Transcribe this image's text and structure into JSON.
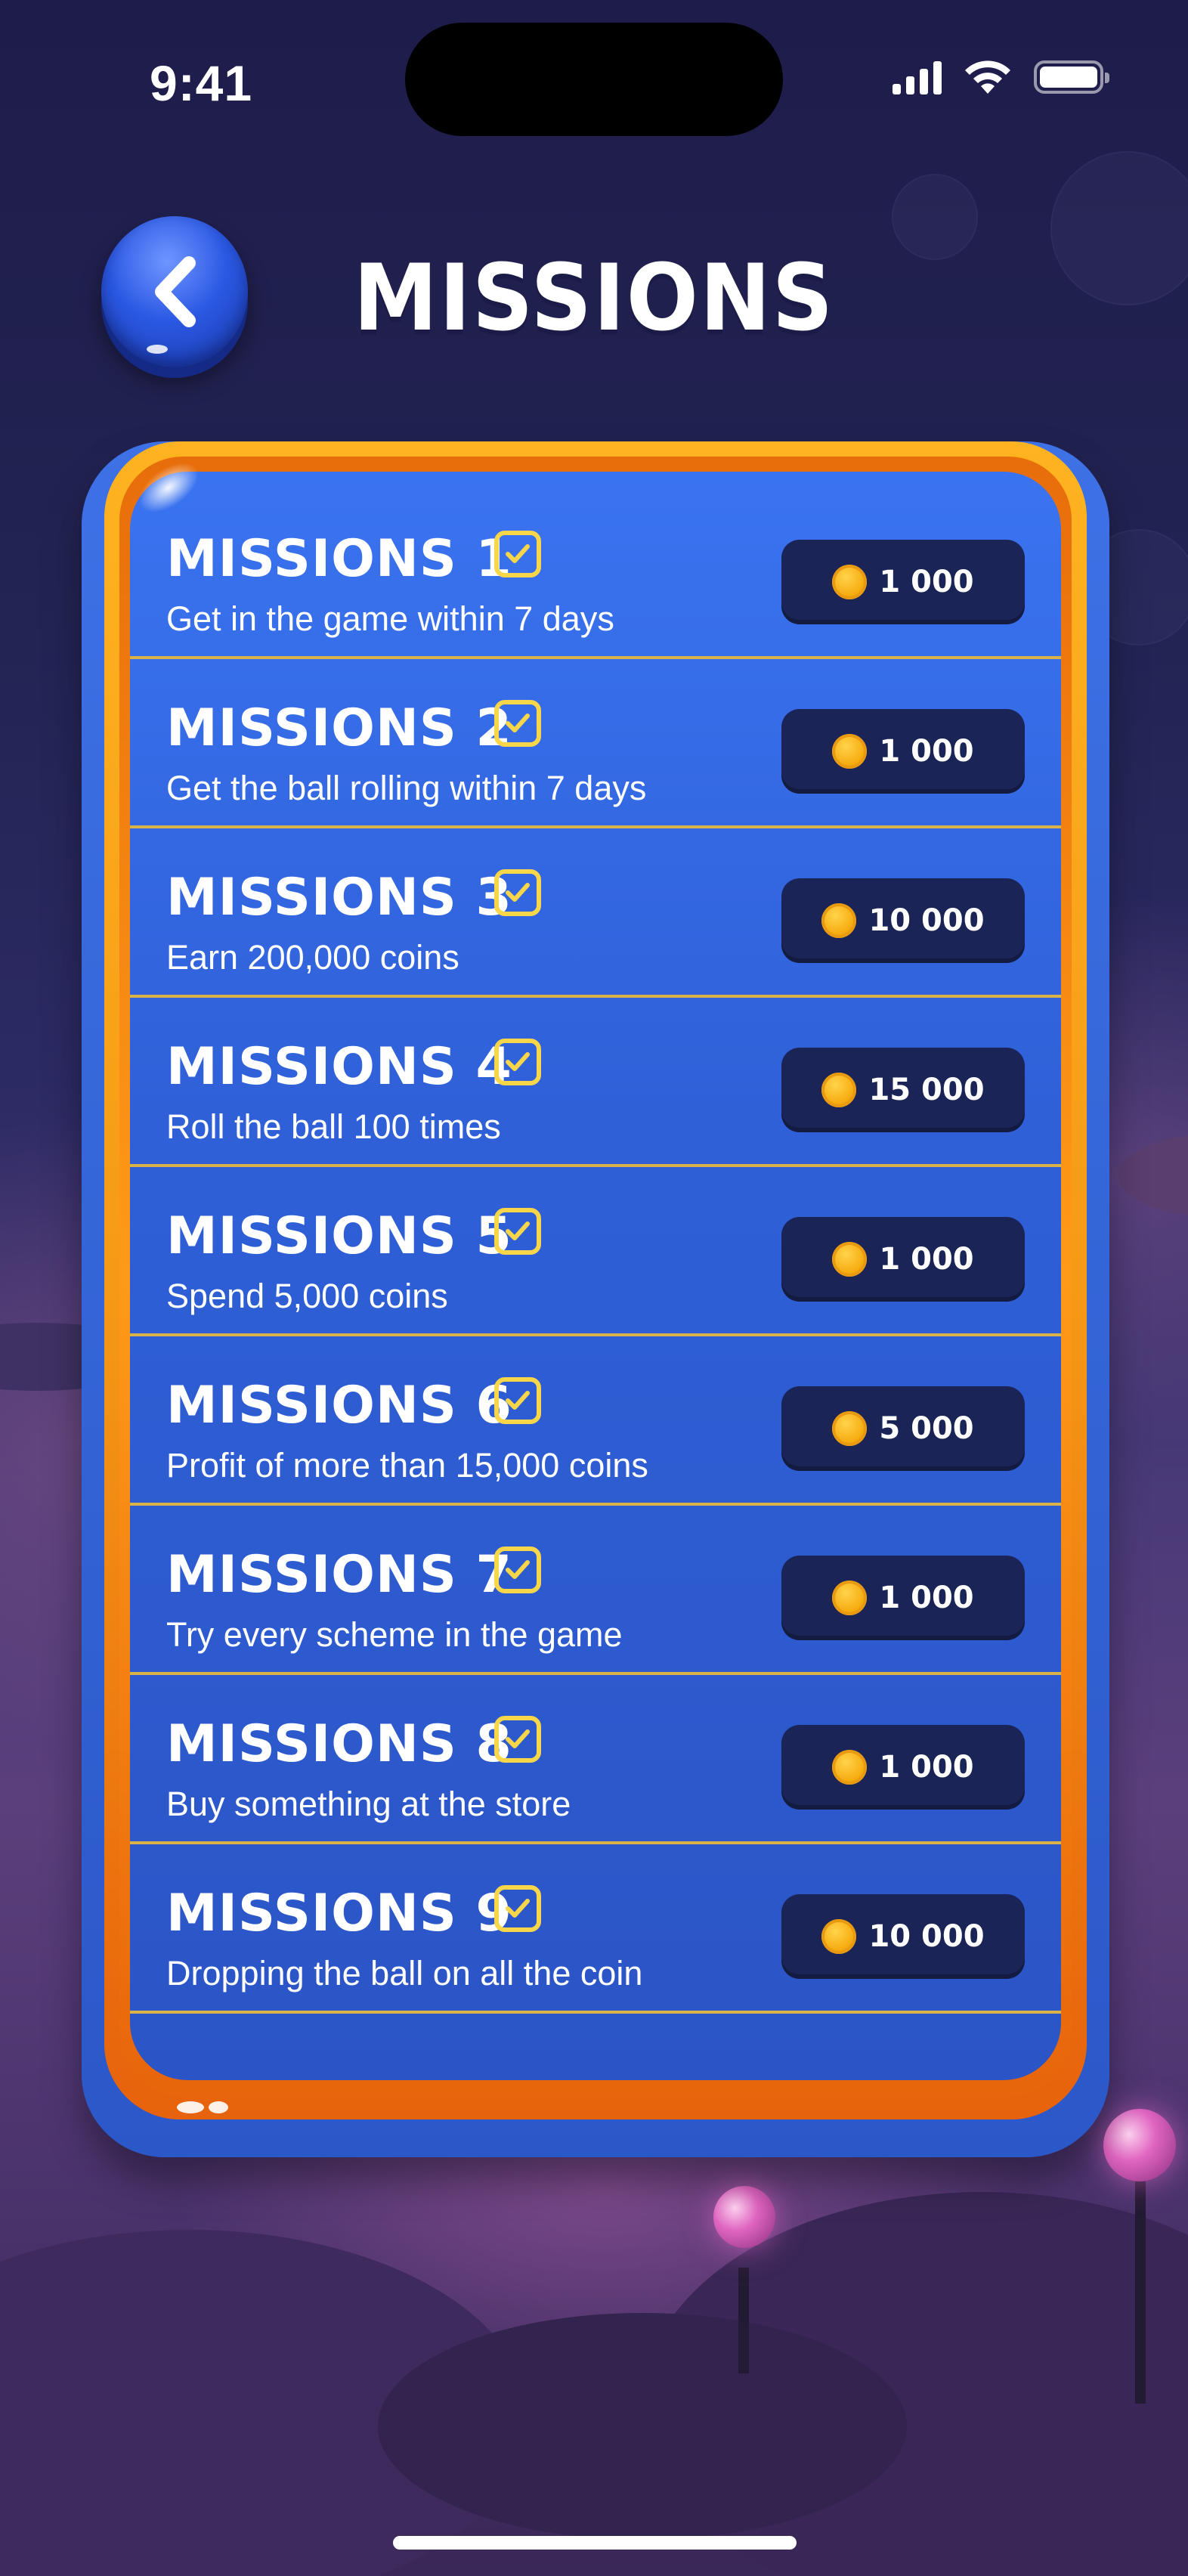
{
  "status_bar": {
    "time": "9:41"
  },
  "header": {
    "title": "MISSIONS",
    "back_icon": "chevron-left-icon"
  },
  "missions": [
    {
      "title": "MISSIONS 1",
      "description": "Get in the game within 7 days",
      "reward": "1 000",
      "completed": true
    },
    {
      "title": "MISSIONS 2",
      "description": "Get the ball rolling within 7 days",
      "reward": "1 000",
      "completed": true
    },
    {
      "title": "MISSIONS 3",
      "description": "Earn 200,000 coins",
      "reward": "10 000",
      "completed": true
    },
    {
      "title": "MISSIONS 4",
      "description": "Roll the ball 100 times",
      "reward": "15 000",
      "completed": true
    },
    {
      "title": "MISSIONS 5",
      "description": "Spend 5,000 coins",
      "reward": "1 000",
      "completed": true
    },
    {
      "title": "MISSIONS 6",
      "description": "Profit of more than 15,000 coins",
      "reward": "5 000",
      "completed": true
    },
    {
      "title": "MISSIONS 7",
      "description": "Try every scheme in the game",
      "reward": "1 000",
      "completed": true
    },
    {
      "title": "MISSIONS 8",
      "description": "Buy something at the store",
      "reward": "1 000",
      "completed": true
    },
    {
      "title": "MISSIONS 9",
      "description": "Dropping the ball on all the coin",
      "reward": "10 000",
      "completed": true
    }
  ],
  "colors": {
    "panel_blue": "#3a73f0",
    "frame_orange": "#f59a16",
    "reward_pill": "#1a2457",
    "checkbox_yellow": "#f7d64a",
    "coin_gold": "#f7ad12"
  }
}
